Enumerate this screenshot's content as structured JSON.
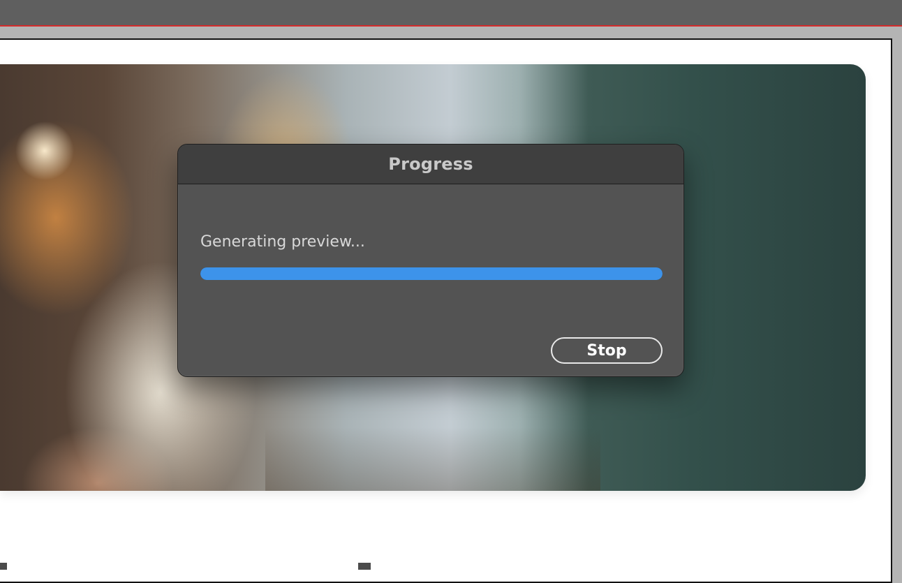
{
  "dialog": {
    "title": "Progress",
    "status_text": "Generating preview...",
    "progress_fraction": 1.0,
    "stop_label": "Stop"
  },
  "colors": {
    "accent": "#3d93ea",
    "dialog_bg": "#535353",
    "titlebar_bg": "#3f3f3f",
    "app_topbar": "#5f5f5f",
    "selection_line": "#d42b2b"
  }
}
